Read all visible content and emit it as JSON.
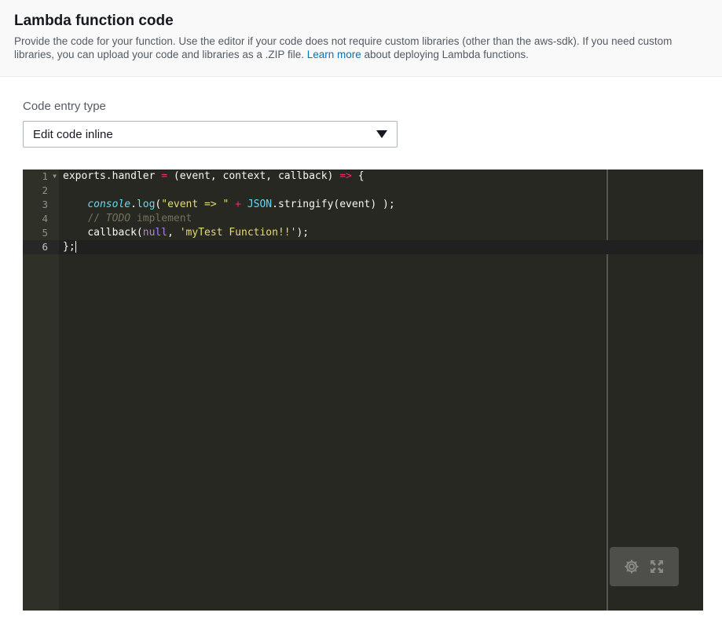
{
  "header": {
    "title": "Lambda function code",
    "description_before": "Provide the code for your function. Use the editor if your code does not require custom libraries (other than the aws-sdk). If you need custom libraries, you can upload your code and libraries as a .ZIP file. ",
    "link_text": "Learn more",
    "description_after": " about deploying Lambda functions."
  },
  "code_entry": {
    "label": "Code entry type",
    "selected": "Edit code inline"
  },
  "editor": {
    "line_numbers": [
      "1",
      "2",
      "3",
      "4",
      "5",
      "6"
    ],
    "active_line": 6,
    "lines": [
      {
        "t1": "exports.handler ",
        "t2": "=",
        "t3": " (event, context, callback) ",
        "t4": "=>",
        "t5": " {"
      },
      {},
      {
        "indent": "    ",
        "obj": "console",
        "dot": ".",
        "fn": "log",
        "p1": "(",
        "str": "\"event => \"",
        "sp": " ",
        "op": "+",
        "sp2": " ",
        "json": "JSON",
        "rest": ".stringify(event) );"
      },
      {
        "indent": "    ",
        "cmt": "// ",
        "todo": "TODO",
        "cmt2": " implement"
      },
      {
        "indent": "    ",
        "pre": "callback(",
        "nul": "null",
        "mid": ", ",
        "str": "'myTest Function!!'",
        "post": ");"
      },
      {
        "text": "};"
      }
    ]
  },
  "tools": {
    "settings_icon": "gear-icon",
    "fullscreen_icon": "expand-icon"
  }
}
